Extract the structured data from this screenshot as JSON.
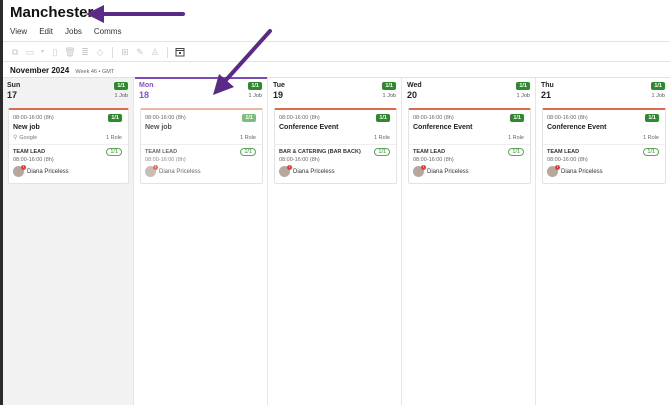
{
  "app": {
    "title": "Manchester"
  },
  "menu": {
    "items": [
      "View",
      "Edit",
      "Jobs",
      "Comms"
    ]
  },
  "toolbar": {
    "icons": [
      "copy-icon",
      "paste-icon",
      "dropdown-icon",
      "doc-icon",
      "trash-icon",
      "stack-icon",
      "hide-icon",
      "add-icon",
      "edit-icon",
      "assign-icon",
      "calendar-icon"
    ]
  },
  "period": {
    "label": "November 2024",
    "week": "Week 46 • GMT"
  },
  "days": [
    {
      "name": "Sun",
      "num": "17",
      "ratio": "1/1",
      "jobs": "1 Job",
      "card": {
        "time": "08:00-16:00 (8h)",
        "badge": "1/1",
        "title": "New job",
        "location": "Google",
        "roles": "1 Role",
        "role": {
          "name": "TEAM LEAD",
          "badge": "1/1",
          "time": "08:00-16:00 (8h)",
          "person": "Diana Priceless"
        }
      }
    },
    {
      "name": "Mon",
      "num": "18",
      "ratio": "1/1",
      "jobs": "1 Job",
      "card": {
        "time": "08:00-16:00 (8h)",
        "badge": "1/1",
        "title": "New job",
        "location": "",
        "roles": "1 Role",
        "role": {
          "name": "TEAM LEAD",
          "badge": "1/1",
          "time": "08:00-16:00 (8h)",
          "person": "Diana Priceless"
        }
      }
    },
    {
      "name": "Tue",
      "num": "19",
      "ratio": "1/1",
      "jobs": "1 Job",
      "card": {
        "time": "08:00-16:00 (8h)",
        "badge": "1/1",
        "title": "Conference Event",
        "location": "",
        "roles": "1 Role",
        "role": {
          "name": "BAR & CATERING (BAR BACK)",
          "badge": "1/1",
          "time": "08:00-16:00 (8h)",
          "person": "Diana Priceless"
        }
      }
    },
    {
      "name": "Wed",
      "num": "20",
      "ratio": "1/1",
      "jobs": "1 Job",
      "card": {
        "time": "08:00-16:00 (8h)",
        "badge": "1/1",
        "title": "Conference Event",
        "location": "",
        "roles": "1 Role",
        "role": {
          "name": "TEAM LEAD",
          "badge": "1/1",
          "time": "08:00-16:00 (8h)",
          "person": "Diana Priceless"
        }
      }
    },
    {
      "name": "Thu",
      "num": "21",
      "ratio": "1/1",
      "jobs": "1 Job",
      "card": {
        "time": "08:00-16:00 (8h)",
        "badge": "1/1",
        "title": "Conference Event",
        "location": "",
        "roles": "1 Role",
        "role": {
          "name": "TEAM LEAD",
          "badge": "1/1",
          "time": "08:00-16:00 (8h)",
          "person": "Diana Priceless"
        }
      }
    }
  ],
  "colors": {
    "accent": "#7b4bb8",
    "ratio_green": "#2f8a2f",
    "card_top": "#d96b4c",
    "annotation": "#5b2a86"
  }
}
